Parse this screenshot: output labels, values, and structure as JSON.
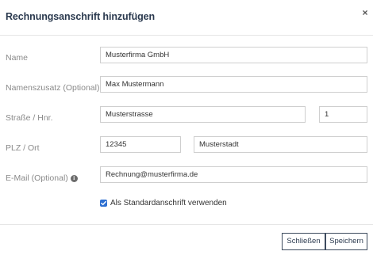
{
  "dialog": {
    "title": "Rechnungsanschrift hinzufügen",
    "close_label": "×"
  },
  "form": {
    "name_label": "Name",
    "name_value": "Musterfirma GmbH",
    "addition_label": "Namenszusatz (Optional)",
    "addition_value": "Max Mustermann",
    "street_label": "Straße / Hnr.",
    "street_value": "Musterstrasse",
    "house_number_value": "1",
    "zip_city_label": "PLZ / Ort",
    "zip_value": "12345",
    "city_value": "Musterstadt",
    "email_label": "E-Mail (Optional)",
    "email_value": "Rechnung@musterfirma.de",
    "info_icon": "i",
    "default_checkbox_checked": true,
    "default_checkbox_label": "Als Standardanschrift verwenden"
  },
  "footer": {
    "close_button": "Schließen",
    "save_button": "Speichern"
  },
  "colors": {
    "accent": "#2d6fd1",
    "title": "#2b3a4f",
    "label": "#8a8a8a",
    "border": "#cfcfcf"
  }
}
